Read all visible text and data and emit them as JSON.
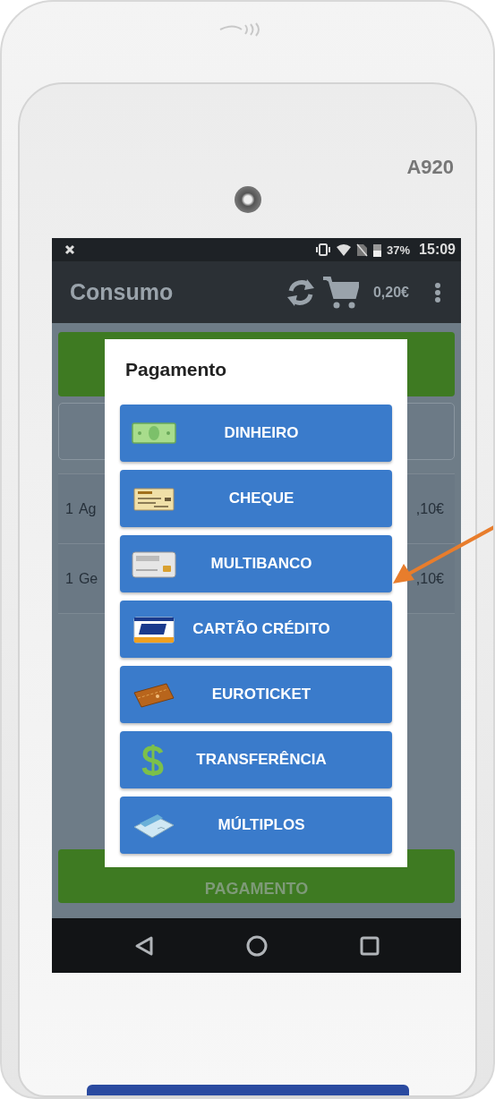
{
  "device": {
    "model": "A920"
  },
  "status_bar": {
    "battery": "37%",
    "time": "15:09"
  },
  "app_bar": {
    "title": "Consumo",
    "total": "0,20€"
  },
  "order_lines": [
    {
      "qty": "1",
      "name": "Ag",
      "price": ",10€"
    },
    {
      "qty": "1",
      "name": "Ge",
      "price": ",10€"
    }
  ],
  "bottom_button": {
    "label": "PAGAMENTO"
  },
  "dialog": {
    "title": "Pagamento",
    "options": [
      {
        "label": "DINHEIRO",
        "kind": "cash"
      },
      {
        "label": "CHEQUE",
        "kind": "cheque"
      },
      {
        "label": "MULTIBANCO",
        "kind": "debit"
      },
      {
        "label": "CARTÃO CRÉDITO",
        "kind": "credit"
      },
      {
        "label": "EUROTICKET",
        "kind": "ticket"
      },
      {
        "label": "TRANSFERÊNCIA",
        "kind": "transfer"
      },
      {
        "label": "MÚLTIPLOS",
        "kind": "multiple"
      }
    ]
  }
}
